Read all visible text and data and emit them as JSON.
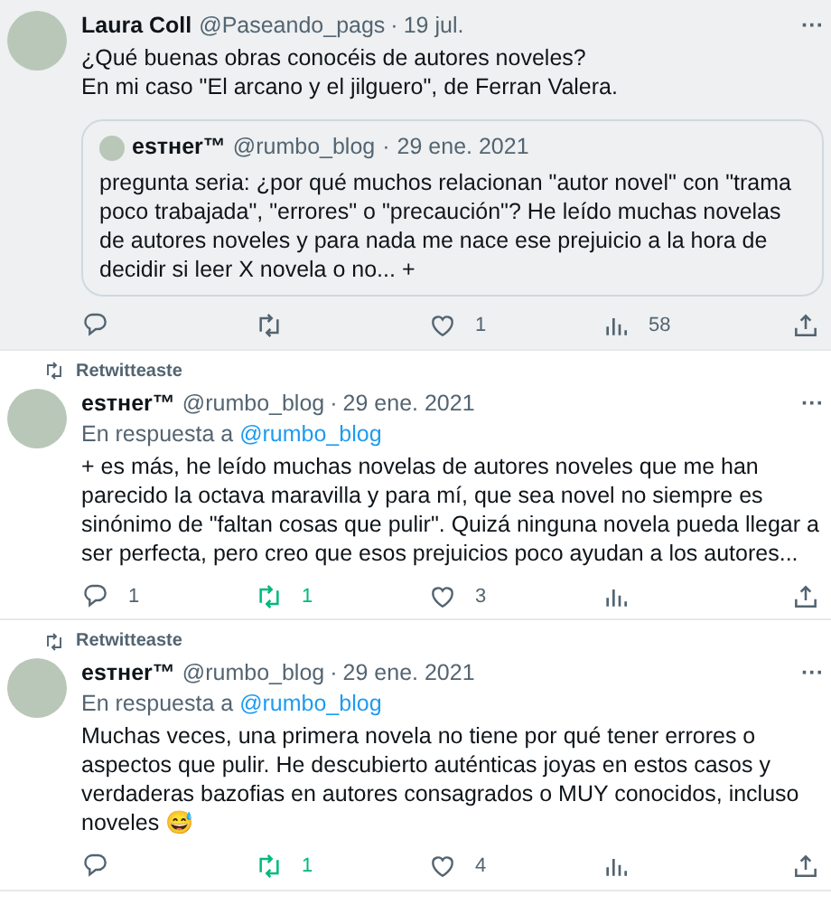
{
  "tweets": [
    {
      "highlighted": true,
      "author": {
        "name": "Laura Coll",
        "handle": "@Paseando_pags",
        "separator": "·",
        "date": "19 jul."
      },
      "more": "···",
      "text": [
        "¿Qué buenas obras conocéis de autores noveles?",
        "En mi caso \"El arcano y el jilguero\", de Ferran Valera."
      ],
      "quote": {
        "name": "esтнer™",
        "handle": "@rumbo_blog",
        "separator": "·",
        "date": "29 ene. 2021",
        "text": "pregunta seria: ¿por qué muchos relacionan \"autor novel\" con \"trama poco trabajada\", \"errores\" o \"precaución\"? He leído muchas novelas de autores noveles y para nada me nace ese prejuicio a la hora de decidir si leer X novela o no... +"
      },
      "actions": {
        "retweeted": false,
        "likes": "1",
        "views": "58"
      }
    },
    {
      "highlighted": false,
      "retweet_label": "Retwitteaste",
      "author": {
        "name": "esтнer™",
        "handle": "@rumbo_blog",
        "separator": "·",
        "date": "29 ene. 2021"
      },
      "more": "···",
      "reply_to": {
        "prefix": "En respuesta a",
        "handle": "@rumbo_blog"
      },
      "text": [
        "+ es más, he leído muchas novelas de autores noveles que me han parecido la octava maravilla y para mí, que sea novel no siempre es sinónimo de \"faltan cosas que pulir\". Quizá ninguna novela pueda llegar a ser perfecta, pero creo que esos prejuicios poco ayudan a los autores..."
      ],
      "actions": {
        "replies": "1",
        "retweets": "1",
        "retweeted": true,
        "likes": "3"
      }
    },
    {
      "highlighted": false,
      "retweet_label": "Retwitteaste",
      "author": {
        "name": "esтнer™",
        "handle": "@rumbo_blog",
        "separator": "·",
        "date": "29 ene. 2021"
      },
      "more": "···",
      "reply_to": {
        "prefix": "En respuesta a",
        "handle": "@rumbo_blog"
      },
      "text": [
        "Muchas veces, una primera novela no tiene por qué tener errores o aspectos que pulir. He descubierto auténticas joyas en estos casos y verdaderas bazofias en autores consagrados o MUY conocidos, incluso noveles 😅"
      ],
      "actions": {
        "retweets": "1",
        "retweeted": true,
        "likes": "4"
      }
    }
  ]
}
